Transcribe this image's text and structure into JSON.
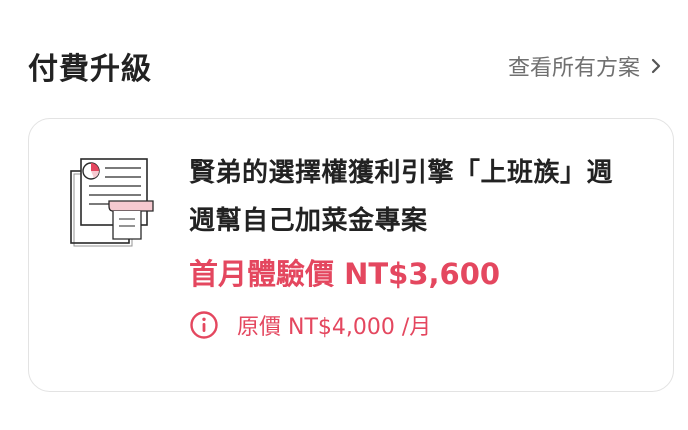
{
  "section": {
    "title": "付費升級",
    "see_all_label": "查看所有方案"
  },
  "plan": {
    "title": "賢弟的選擇權獲利引擎「上班族」週週幫自己加菜金專案",
    "promo_price": "首月體驗價 NT$3,600",
    "original_price": "原價 NT$4,000 /月"
  },
  "colors": {
    "accent": "#e4475f",
    "muted_text": "#707070",
    "border": "#e3e3e3"
  },
  "icons": {
    "chevron": "chevron-right-icon",
    "document": "document-chart-icon",
    "info": "info-icon"
  }
}
